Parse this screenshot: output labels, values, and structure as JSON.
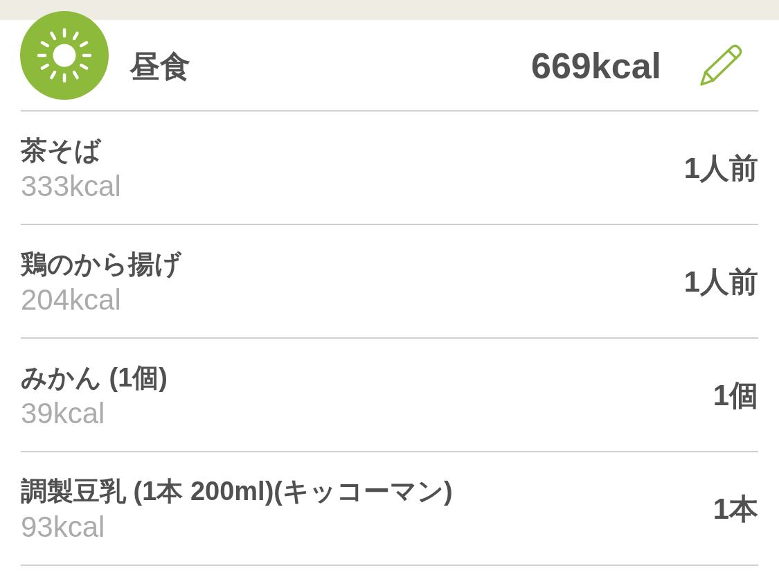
{
  "meal": {
    "title": "昼食",
    "total": "669kcal"
  },
  "items": [
    {
      "name": "茶そば",
      "calories": "333kcal",
      "portion": "1人前"
    },
    {
      "name": "鶏のから揚げ",
      "calories": "204kcal",
      "portion": "1人前"
    },
    {
      "name": "みかん (1個)",
      "calories": "39kcal",
      "portion": "1個"
    },
    {
      "name": "調製豆乳 (1本 200ml)(キッコーマン)",
      "calories": "93kcal",
      "portion": "1本"
    }
  ]
}
